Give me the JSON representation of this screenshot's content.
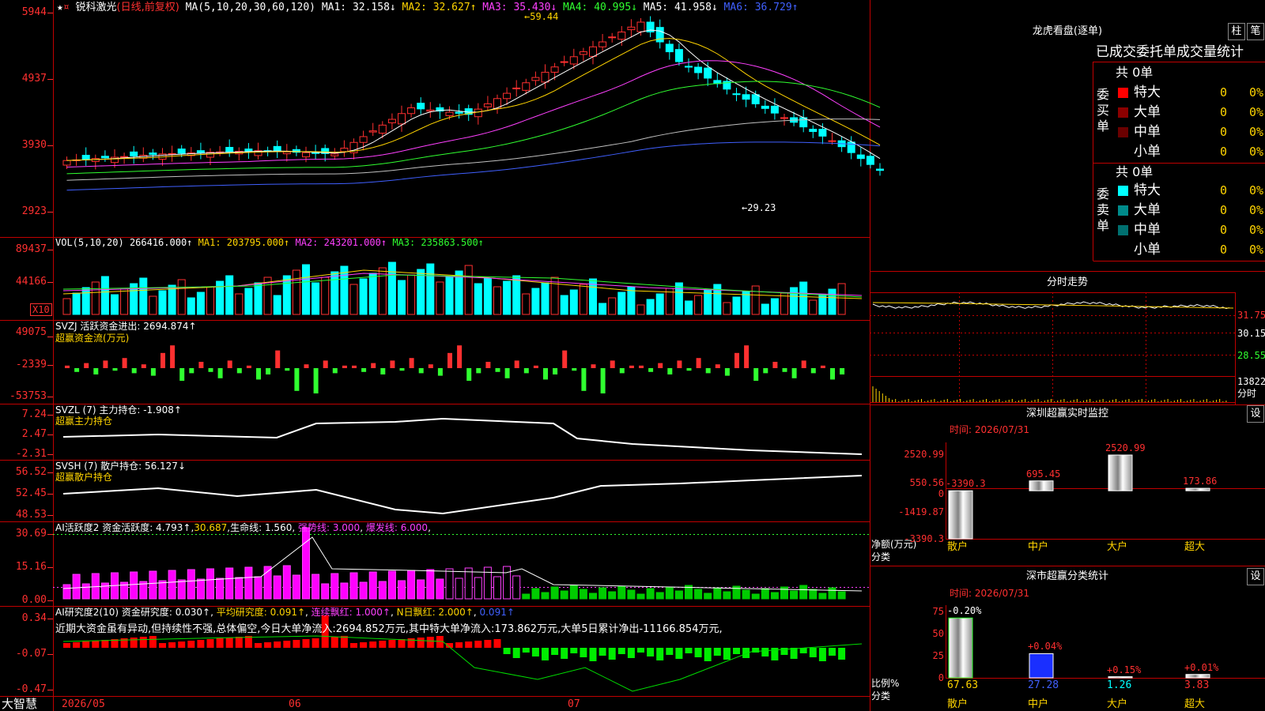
{
  "stock": {
    "name": "锐科激光",
    "period_label": "(日线,前复权)",
    "ma_params": "MA(5,10,20,30,60,120)",
    "ma": [
      {
        "label": "MA1:",
        "value": "32.158↓",
        "color": "#ffffff"
      },
      {
        "label": "MA2:",
        "value": "32.627↑",
        "color": "#ffd400"
      },
      {
        "label": "MA3:",
        "value": "35.430↓",
        "color": "#ff40ff"
      },
      {
        "label": "MA4:",
        "value": "40.995↓",
        "color": "#30ff30"
      },
      {
        "label": "MA5:",
        "value": "41.958↓",
        "color": "#ffffff"
      },
      {
        "label": "MA6:",
        "value": "36.729↑",
        "color": "#4060ff"
      }
    ],
    "high_note": "←59.44",
    "low_note": "←29.23",
    "star": "★",
    "mark": "¤"
  },
  "price_axis": [
    "5944",
    "4937",
    "3930",
    "2923"
  ],
  "vol": {
    "header_l": "VOL(5,10,20)",
    "value": "266416.000↑",
    "ma1": "MA1: 203795.000↑",
    "ma2": "MA2: 243201.000↑",
    "ma3": "MA3: 235863.500↑",
    "axis": [
      "89437",
      "44166"
    ],
    "unit": "X10"
  },
  "svzj": {
    "header": "SVZJ  活跃资金进出: 2694.874↑",
    "sub": "超赢资金流(万元)",
    "axis": [
      "49075",
      "-2339",
      "-53753"
    ]
  },
  "svzl": {
    "header": "SVZL (7) 主力持仓: -1.908↑",
    "sub": "超赢主力持仓",
    "axis": [
      "7.24",
      "2.47",
      "-2.31"
    ]
  },
  "svsh": {
    "header": "SVSH (7) 散户持仓: 56.127↓",
    "sub": "超赢散户持仓",
    "axis": [
      "56.52",
      "52.45",
      "48.53"
    ]
  },
  "ai1": {
    "header_l": "AI活跃度2 资金活跃度: 4.793↑",
    "v2": "30.687",
    "life": "生命线: 1.560",
    "strong": "强势线: 3.000",
    "burst": "爆发线: 6.000",
    "axis": [
      "30.69",
      "15.16",
      "0.00"
    ]
  },
  "ai2": {
    "header_l": "AI研究度2(10) 资金研究度: 0.030↑",
    "avg": "平均研究度: 0.091↑",
    "red": "连续飘红: 1.000↑",
    "nred": "N日飘红: 2.000↑",
    "last": "0.091↑",
    "note": "近期大资金虽有异动,但持续性不强,总体偏空,今日大单净流入:2694.852万元,其中特大单净流入:173.862万元,大单5日累计净出-11166.854万元,",
    "axis": [
      "0.34",
      "-0.07",
      "-0.47"
    ]
  },
  "bottom": {
    "brand": "大智慧",
    "dates": [
      "2026/05",
      "06",
      "07"
    ]
  },
  "lhb": {
    "title": "龙虎看盘(逐单)",
    "btn1": "柱",
    "btn2": "笔",
    "tabs": "已成交委托单成交量统计",
    "buy_label": "委买单",
    "sell_label": "委卖单",
    "buy_total": "共 0单",
    "sell_total": "共 0单",
    "rows_buy": [
      {
        "label": "特大",
        "color": "#ff0000",
        "n": "0",
        "p": "0%"
      },
      {
        "label": "大单",
        "color": "#8b0000",
        "n": "0",
        "p": "0%"
      },
      {
        "label": "中单",
        "color": "#6a0000",
        "n": "0",
        "p": "0%"
      },
      {
        "label": "小单",
        "color": "",
        "n": "0",
        "p": "0%"
      }
    ],
    "rows_sell": [
      {
        "label": "特大",
        "color": "#00ffff",
        "n": "0",
        "p": "0%"
      },
      {
        "label": "大单",
        "color": "#008b8b",
        "n": "0",
        "p": "0%"
      },
      {
        "label": "中单",
        "color": "#007070",
        "n": "0",
        "p": "0%"
      },
      {
        "label": "小单",
        "color": "",
        "n": "0",
        "p": "0%"
      }
    ]
  },
  "intraday": {
    "title": "分时走势",
    "axis": [
      "31.75",
      "30.15",
      "28.55",
      "13822",
      "分时"
    ]
  },
  "sz_monitor": {
    "title": "深圳超赢实时监控",
    "btn": "设",
    "time": "时间: 2026/07/31",
    "axis": [
      "2520.99",
      "550.56",
      "0",
      "-1419.87",
      "-3390.3"
    ],
    "ylab": "净额(万元)",
    "xlab": "分类",
    "chart_data": {
      "type": "bar",
      "categories": [
        "散户",
        "中户",
        "大户",
        "超大"
      ],
      "values": [
        -3390.3,
        695.45,
        2520.99,
        173.86
      ],
      "ylim": [
        -3390.3,
        2520.99
      ]
    }
  },
  "sz_class": {
    "title": "深市超赢分类统计",
    "btn": "设",
    "time": "时间: 2026/07/31",
    "axis": [
      "75",
      "50",
      "25",
      "0"
    ],
    "ylab": "比例%",
    "xlab": "分类",
    "chart_data": {
      "type": "bar",
      "categories": [
        "散户",
        "中户",
        "大户",
        "超大"
      ],
      "values": [
        67.63,
        27.28,
        1.26,
        3.83
      ],
      "changes": [
        "-0.20%",
        "+0.04%",
        "+0.15%",
        "+0.01%"
      ],
      "ylim": [
        0,
        75
      ]
    }
  }
}
